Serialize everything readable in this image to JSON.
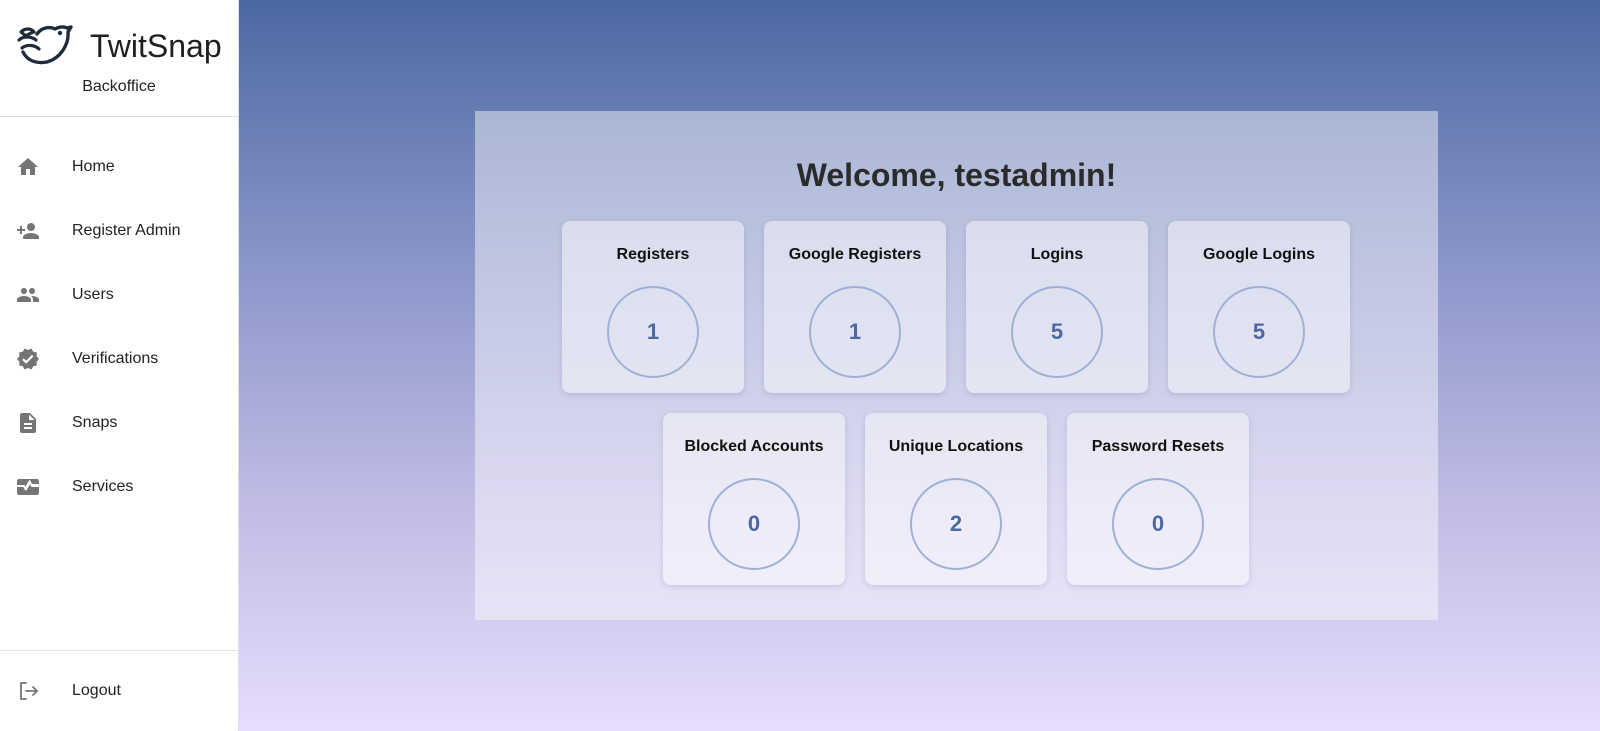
{
  "brand": {
    "name": "TwitSnap",
    "subtitle": "Backoffice"
  },
  "sidebar": {
    "items": [
      {
        "label": "Home",
        "icon": "home-icon"
      },
      {
        "label": "Register Admin",
        "icon": "person-add-icon"
      },
      {
        "label": "Users",
        "icon": "people-icon"
      },
      {
        "label": "Verifications",
        "icon": "verified-icon"
      },
      {
        "label": "Snaps",
        "icon": "document-icon"
      },
      {
        "label": "Services",
        "icon": "monitor-heart-icon"
      }
    ],
    "logout": {
      "label": "Logout",
      "icon": "logout-icon"
    }
  },
  "main": {
    "welcome": "Welcome, testadmin!",
    "stats": [
      {
        "title": "Registers",
        "value": "1"
      },
      {
        "title": "Google Registers",
        "value": "1"
      },
      {
        "title": "Logins",
        "value": "5"
      },
      {
        "title": "Google Logins",
        "value": "5"
      },
      {
        "title": "Blocked Accounts",
        "value": "0"
      },
      {
        "title": "Unique Locations",
        "value": "2"
      },
      {
        "title": "Password Resets",
        "value": "0"
      }
    ]
  },
  "colors": {
    "accent": "#4c68a2",
    "circle_border": "#9fb0d6",
    "icon": "#757575"
  }
}
